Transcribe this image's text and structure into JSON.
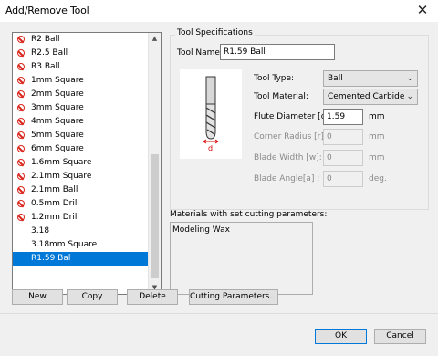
{
  "window": {
    "title": "Add/Remove Tool",
    "close_glyph": "✕"
  },
  "tool_list": {
    "items": [
      {
        "label": "R2 Ball",
        "icon": "prohibited-icon"
      },
      {
        "label": "R2.5 Ball",
        "icon": "prohibited-icon"
      },
      {
        "label": "R3 Ball",
        "icon": "prohibited-icon"
      },
      {
        "label": "1mm Square",
        "icon": "prohibited-icon"
      },
      {
        "label": "2mm Square",
        "icon": "prohibited-icon"
      },
      {
        "label": "3mm Square",
        "icon": "prohibited-icon"
      },
      {
        "label": "4mm Square",
        "icon": "prohibited-icon"
      },
      {
        "label": "5mm Square",
        "icon": "prohibited-icon"
      },
      {
        "label": "6mm Square",
        "icon": "prohibited-icon"
      },
      {
        "label": "1.6mm Square",
        "icon": "prohibited-icon"
      },
      {
        "label": "2.1mm Square",
        "icon": "prohibited-icon"
      },
      {
        "label": "2.1mm Ball",
        "icon": "prohibited-icon"
      },
      {
        "label": "0.5mm Drill",
        "icon": "prohibited-icon"
      },
      {
        "label": "1.2mm Drill",
        "icon": "prohibited-icon"
      },
      {
        "label": "3.18",
        "icon": ""
      },
      {
        "label": "3.18mm Square",
        "icon": ""
      },
      {
        "label": "R1.59 Bal",
        "icon": "",
        "selected": true
      }
    ]
  },
  "spec": {
    "group_title": "Tool Specifications",
    "tool_name_label": "Tool Name:",
    "tool_name_value": "R1.59 Ball",
    "tool_type_label": "Tool Type:",
    "tool_type_value": "Ball",
    "tool_material_label": "Tool Material:",
    "tool_material_value": "Cemented Carbide",
    "flute_label": "Flute Diameter [d]:",
    "flute_value": "1.59",
    "flute_unit": "mm",
    "corner_label": "Corner Radius [r]:",
    "corner_value": "0",
    "corner_unit": "mm",
    "blade_width_label": "Blade Width [w]:",
    "blade_width_value": "0",
    "blade_width_unit": "mm",
    "blade_angle_label": "Blade Angle[a] :",
    "blade_angle_value": "0",
    "blade_angle_unit": "deg.",
    "diagram_label": "d"
  },
  "materials": {
    "label": "Materials with set cutting parameters:",
    "items": [
      "Modeling Wax"
    ]
  },
  "buttons": {
    "new": "New",
    "copy": "Copy",
    "delete": "Delete",
    "cutting": "Cutting Parameters...",
    "ok": "OK",
    "cancel": "Cancel"
  },
  "colors": {
    "selection": "#0078d7",
    "prohibited": "#d9261c"
  }
}
